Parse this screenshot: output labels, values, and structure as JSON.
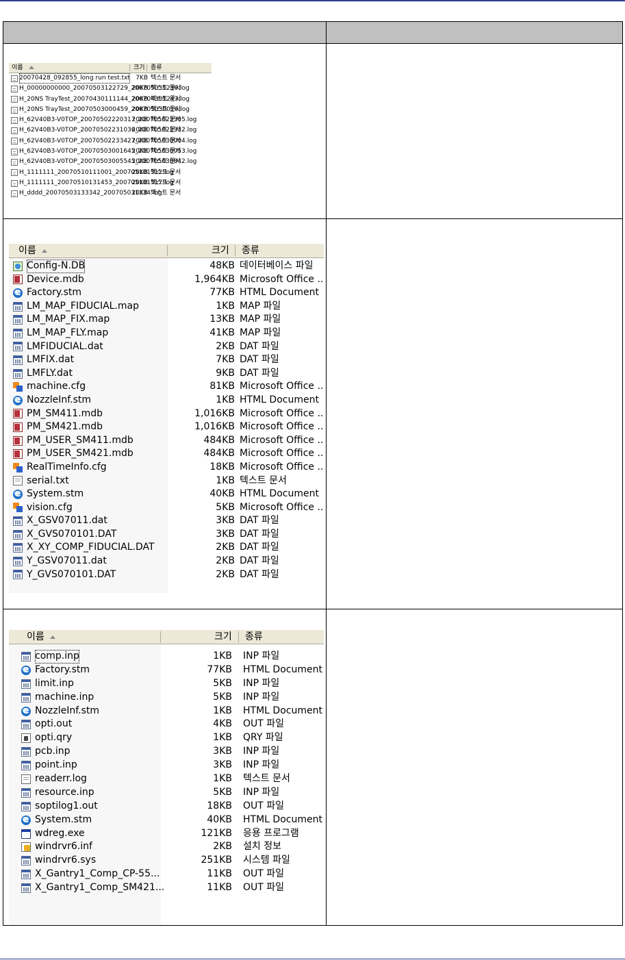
{
  "table": {
    "col1_header": "",
    "col2_header": ""
  },
  "colors": {
    "top_rule": "#2a3b8f",
    "header_bg": "#c0c0c0"
  },
  "listings": [
    {
      "header": {
        "name": "이름",
        "size": "크기",
        "type": "종류"
      },
      "rows": [
        {
          "icon": "text-file-icon",
          "name": "20070428_092855_long run test.txt",
          "size": "7KB",
          "type": "텍스트 문서"
        },
        {
          "icon": "text-file-icon",
          "name": "H_00000000000_20070503122729_200705031236.log",
          "size": "20KB",
          "type": "텍스트 문서"
        },
        {
          "icon": "text-file-icon",
          "name": "H_20NS TrayTest_20070430111144_200704301243.log",
          "size": "20KB",
          "type": "텍스트 문서"
        },
        {
          "icon": "text-file-icon",
          "name": "H_20NS TrayTest_20070503000459_200705030016.log",
          "size": "20KB",
          "type": "텍스트 문서"
        },
        {
          "icon": "text-file-icon",
          "name": "H_62V40B3-V0TOP_20070502220317_200705022305.log",
          "size": "20KB",
          "type": "텍스트 문서"
        },
        {
          "icon": "text-file-icon",
          "name": "H_62V40B3-V0TOP_20070502231036_200705022332.log",
          "size": "20KB",
          "type": "텍스트 문서"
        },
        {
          "icon": "text-file-icon",
          "name": "H_62V40B3-V0TOP_20070502233427_200705030004.log",
          "size": "20KB",
          "type": "텍스트 문서"
        },
        {
          "icon": "text-file-icon",
          "name": "H_62V40B3-V0TOP_20070503001645_200705030053.log",
          "size": "20KB",
          "type": "텍스트 문서"
        },
        {
          "icon": "text-file-icon",
          "name": "H_62V40B3-V0TOP_20070503005545_200705030842.log",
          "size": "20KB",
          "type": "텍스트 문서"
        },
        {
          "icon": "text-file-icon",
          "name": "H_1111111_20070510111001_200705101312.log",
          "size": "20KB",
          "type": "텍스트 문서"
        },
        {
          "icon": "text-file-icon",
          "name": "H_1111111_20070510131453_200705101317.log",
          "size": "20KB",
          "type": "텍스트 문서"
        },
        {
          "icon": "text-file-icon",
          "name": "H_dddd_20070503133342_200705031334.log",
          "size": "20KB",
          "type": "텍스트 문서"
        }
      ]
    },
    {
      "header": {
        "name": "이름",
        "size": "크기",
        "type": "종류"
      },
      "rows": [
        {
          "icon": "database-icon",
          "name": "Config-N.DB",
          "size": "48KB",
          "type": "데이터베이스 파일"
        },
        {
          "icon": "access-icon",
          "name": "Device.mdb",
          "size": "1,964KB",
          "type": "Microsoft Office ..."
        },
        {
          "icon": "ie-icon",
          "name": "Factory.stm",
          "size": "77KB",
          "type": "HTML Document"
        },
        {
          "icon": "generic-file-icon",
          "name": "LM_MAP_FIDUCIAL.map",
          "size": "1KB",
          "type": "MAP 파일"
        },
        {
          "icon": "generic-file-icon",
          "name": "LM_MAP_FIX.map",
          "size": "13KB",
          "type": "MAP 파일"
        },
        {
          "icon": "generic-file-icon",
          "name": "LM_MAP_FLY.map",
          "size": "41KB",
          "type": "MAP 파일"
        },
        {
          "icon": "generic-file-icon",
          "name": "LMFIDUCIAL.dat",
          "size": "2KB",
          "type": "DAT 파일"
        },
        {
          "icon": "generic-file-icon",
          "name": "LMFIX.dat",
          "size": "7KB",
          "type": "DAT 파일"
        },
        {
          "icon": "generic-file-icon",
          "name": "LMFLY.dat",
          "size": "9KB",
          "type": "DAT 파일"
        },
        {
          "icon": "config-icon",
          "name": "machine.cfg",
          "size": "81KB",
          "type": "Microsoft Office ..."
        },
        {
          "icon": "ie-icon",
          "name": "NozzleInf.stm",
          "size": "1KB",
          "type": "HTML Document"
        },
        {
          "icon": "access-icon",
          "name": "PM_SM411.mdb",
          "size": "1,016KB",
          "type": "Microsoft Office ..."
        },
        {
          "icon": "access-icon",
          "name": "PM_SM421.mdb",
          "size": "1,016KB",
          "type": "Microsoft Office ..."
        },
        {
          "icon": "access-icon",
          "name": "PM_USER_SM411.mdb",
          "size": "484KB",
          "type": "Microsoft Office ..."
        },
        {
          "icon": "access-icon",
          "name": "PM_USER_SM421.mdb",
          "size": "484KB",
          "type": "Microsoft Office ..."
        },
        {
          "icon": "config-icon",
          "name": "RealTimeInfo.cfg",
          "size": "18KB",
          "type": "Microsoft Office ..."
        },
        {
          "icon": "text-file-icon",
          "name": "serial.txt",
          "size": "1KB",
          "type": "텍스트 문서"
        },
        {
          "icon": "ie-icon",
          "name": "System.stm",
          "size": "40KB",
          "type": "HTML Document"
        },
        {
          "icon": "config-icon",
          "name": "vision.cfg",
          "size": "5KB",
          "type": "Microsoft Office ..."
        },
        {
          "icon": "generic-file-icon",
          "name": "X_GSV07011.dat",
          "size": "3KB",
          "type": "DAT 파일"
        },
        {
          "icon": "generic-file-icon",
          "name": "X_GVS070101.DAT",
          "size": "3KB",
          "type": "DAT 파일"
        },
        {
          "icon": "generic-file-icon",
          "name": "X_XY_COMP_FIDUCIAL.DAT",
          "size": "2KB",
          "type": "DAT 파일"
        },
        {
          "icon": "generic-file-icon",
          "name": "Y_GSV07011.dat",
          "size": "2KB",
          "type": "DAT 파일"
        },
        {
          "icon": "generic-file-icon",
          "name": "Y_GVS070101.DAT",
          "size": "2KB",
          "type": "DAT 파일"
        }
      ]
    },
    {
      "header": {
        "name": "이름",
        "size": "크기",
        "type": "종류"
      },
      "rows": [
        {
          "icon": "generic-file-icon",
          "name": "comp.inp",
          "size": "1KB",
          "type": "INP 파일"
        },
        {
          "icon": "ie-icon",
          "name": "Factory.stm",
          "size": "77KB",
          "type": "HTML Document"
        },
        {
          "icon": "generic-file-icon",
          "name": "limit.inp",
          "size": "5KB",
          "type": "INP 파일"
        },
        {
          "icon": "generic-file-icon",
          "name": "machine.inp",
          "size": "5KB",
          "type": "INP 파일"
        },
        {
          "icon": "ie-icon",
          "name": "NozzleInf.stm",
          "size": "1KB",
          "type": "HTML Document"
        },
        {
          "icon": "generic-file-icon",
          "name": "opti.out",
          "size": "4KB",
          "type": "OUT 파일"
        },
        {
          "icon": "query-file-icon",
          "name": "opti.qry",
          "size": "1KB",
          "type": "QRY 파일"
        },
        {
          "icon": "generic-file-icon",
          "name": "pcb.inp",
          "size": "3KB",
          "type": "INP 파일"
        },
        {
          "icon": "generic-file-icon",
          "name": "point.inp",
          "size": "3KB",
          "type": "INP 파일"
        },
        {
          "icon": "text-file-icon",
          "name": "readerr.log",
          "size": "1KB",
          "type": "텍스트 문서"
        },
        {
          "icon": "generic-file-icon",
          "name": "resource.inp",
          "size": "5KB",
          "type": "INP 파일"
        },
        {
          "icon": "generic-file-icon",
          "name": "soptilog1.out",
          "size": "18KB",
          "type": "OUT 파일"
        },
        {
          "icon": "ie-icon",
          "name": "System.stm",
          "size": "40KB",
          "type": "HTML Document"
        },
        {
          "icon": "exe-icon",
          "name": "wdreg.exe",
          "size": "121KB",
          "type": "응용 프로그램"
        },
        {
          "icon": "setup-info-icon",
          "name": "windrvr6.inf",
          "size": "2KB",
          "type": "설치 정보"
        },
        {
          "icon": "generic-file-icon",
          "name": "windrvr6.sys",
          "size": "251KB",
          "type": "시스템 파일"
        },
        {
          "icon": "generic-file-icon",
          "name": "X_Gantry1_Comp_CP-55...",
          "size": "11KB",
          "type": "OUT 파일"
        },
        {
          "icon": "generic-file-icon",
          "name": "X_Gantry1_Comp_SM421...",
          "size": "11KB",
          "type": "OUT 파일"
        }
      ]
    }
  ]
}
